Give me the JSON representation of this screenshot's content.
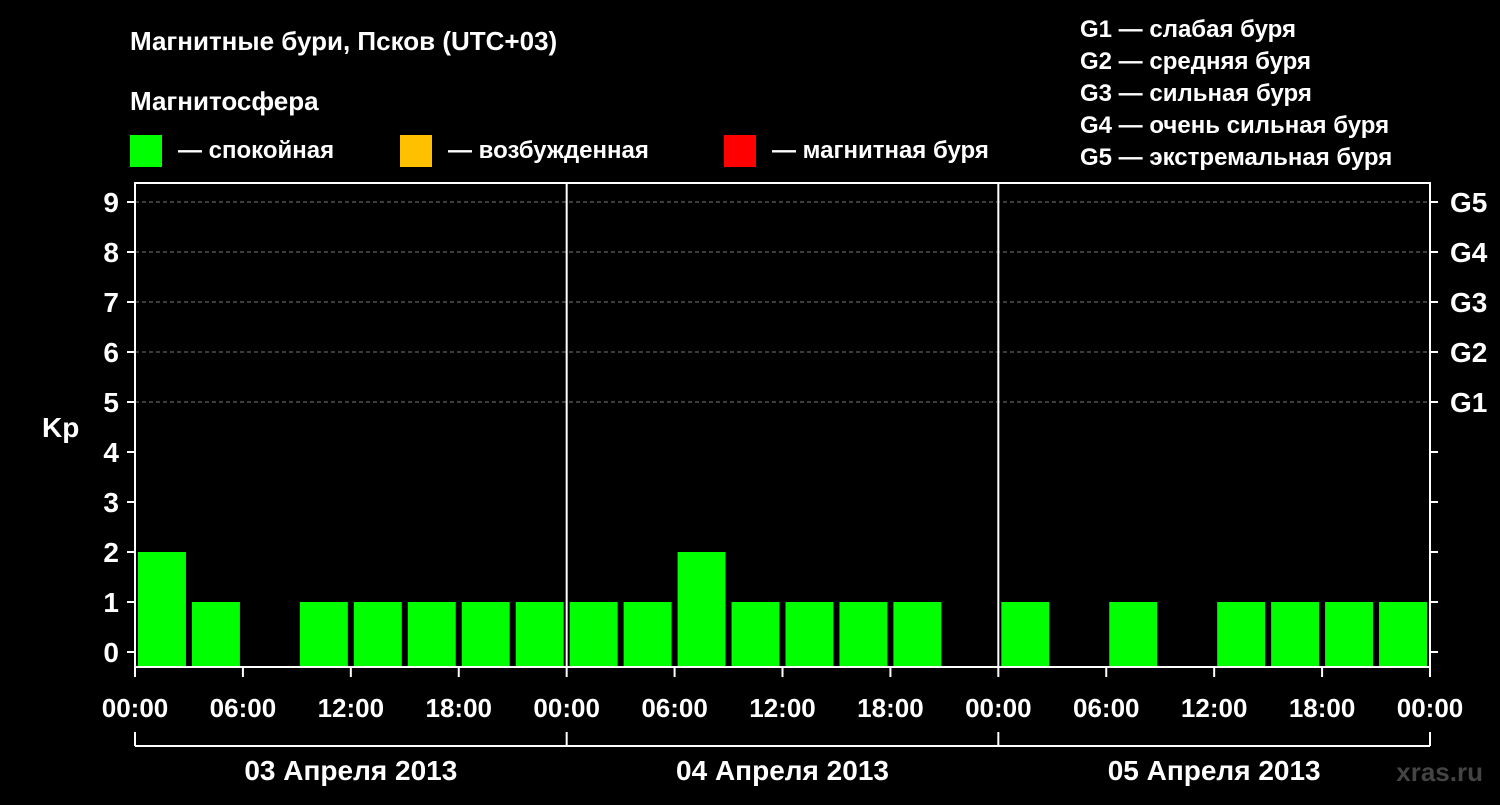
{
  "chart_data": {
    "type": "bar",
    "title": "Магнитные бури, Псков (UTC+03)",
    "ylabel": "Kp",
    "ylim": [
      0,
      9
    ],
    "yticks": [
      "0",
      "1",
      "2",
      "3",
      "4",
      "5",
      "6",
      "7",
      "8",
      "9"
    ],
    "right_axis_labels": [
      {
        "kp": 5,
        "label": "G1"
      },
      {
        "kp": 6,
        "label": "G2"
      },
      {
        "kp": 7,
        "label": "G3"
      },
      {
        "kp": 8,
        "label": "G4"
      },
      {
        "kp": 9,
        "label": "G5"
      }
    ],
    "x_tick_labels": [
      "00:00",
      "06:00",
      "12:00",
      "18:00",
      "00:00",
      "06:00",
      "12:00",
      "18:00",
      "00:00",
      "06:00",
      "12:00",
      "18:00",
      "00:00"
    ],
    "days": [
      "03 Апреля 2013",
      "04 Апреля 2013",
      "05 Апреля 2013"
    ],
    "values": [
      2,
      1,
      0,
      1,
      1,
      1,
      1,
      1,
      1,
      1,
      2,
      1,
      1,
      1,
      1,
      0,
      1,
      0,
      1,
      0,
      1,
      1,
      1,
      1
    ],
    "bar_color": "#00ff00",
    "grid": "dashed at Kp 5-9",
    "legend": {
      "title": "Магнитосфера",
      "items": [
        {
          "color": "#00ff00",
          "label": "— спокойная"
        },
        {
          "color": "#ffc000",
          "label": "— возбужденная"
        },
        {
          "color": "#ff0000",
          "label": "— магнитная буря"
        }
      ]
    },
    "storm_scale": [
      "G1 — слабая буря",
      "G2 — средняя буря",
      "G3 — сильная буря",
      "G4 — очень сильная буря",
      "G5 — экстремальная буря"
    ]
  },
  "watermark": "xras.ru"
}
